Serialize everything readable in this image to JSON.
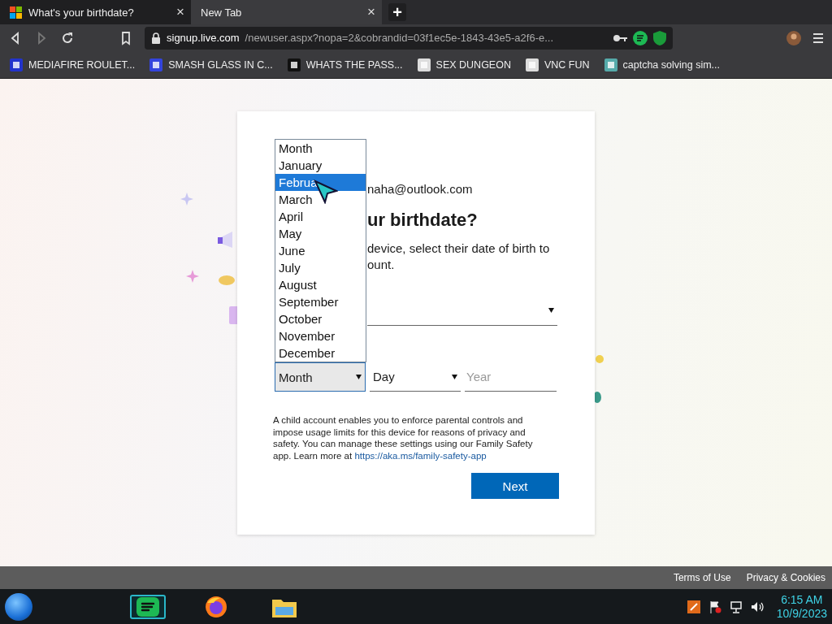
{
  "browser": {
    "tabs": [
      {
        "title": "What's your birthdate?",
        "close": "×",
        "selected": true
      },
      {
        "title": "New Tab",
        "close": "×",
        "selected": false
      }
    ],
    "new_tab": "+",
    "address": {
      "host": "signup.live.com",
      "path": "/newuser.aspx?nopa=2&cobrandid=03f1ec5e-1843-43e5-a2f6-e..."
    },
    "bookmarks": [
      {
        "label": "MEDIAFIRE ROULET..."
      },
      {
        "label": "SMASH GLASS IN C..."
      },
      {
        "label": "WHATS THE PASS..."
      },
      {
        "label": "SEX DUNGEON"
      },
      {
        "label": "VNC FUN"
      },
      {
        "label": "captcha solving sim..."
      }
    ]
  },
  "page": {
    "email": "naha@outlook.com",
    "heading": "ur birthdate?",
    "intro_lines": [
      "device, select their date of birth to",
      "ount."
    ],
    "month_list": [
      {
        "label": "Month",
        "selected": false
      },
      {
        "label": "January",
        "selected": false
      },
      {
        "label": "Februa",
        "selected": true
      },
      {
        "label": "March",
        "selected": false
      },
      {
        "label": "April",
        "selected": false
      },
      {
        "label": "May",
        "selected": false
      },
      {
        "label": "June",
        "selected": false
      },
      {
        "label": "July",
        "selected": false
      },
      {
        "label": "August",
        "selected": false
      },
      {
        "label": "September",
        "selected": false
      },
      {
        "label": "October",
        "selected": false
      },
      {
        "label": "November",
        "selected": false
      },
      {
        "label": "December",
        "selected": false
      }
    ],
    "month_select": {
      "value": "Month",
      "expanded": true
    },
    "day_select": {
      "value": "Day"
    },
    "year_field": {
      "placeholder": "Year"
    },
    "info": "A child account enables you to enforce parental controls and impose usage limits for this device for reasons of privacy and safety. You can manage these settings using our Family Safety app. Learn more at ",
    "info_link": "https://aka.ms/family-safety-app",
    "next_button": "Next"
  },
  "footer": {
    "links": [
      "Terms of Use",
      "Privacy & Cookies"
    ]
  },
  "taskbar": {
    "apps": [
      {
        "kind": "music",
        "selected": true
      },
      {
        "kind": "browser",
        "selected": false
      },
      {
        "kind": "folder",
        "selected": false
      }
    ],
    "time": "6:15 AM",
    "date": "10/9/2023"
  }
}
